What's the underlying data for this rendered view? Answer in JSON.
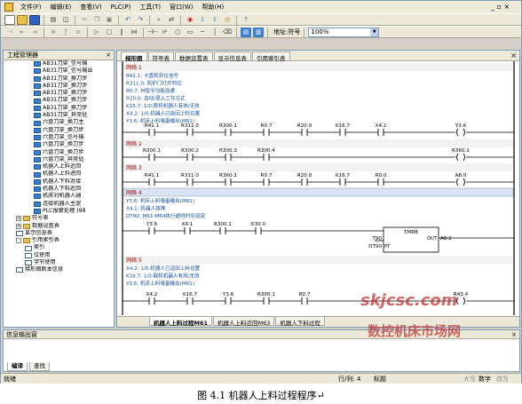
{
  "menubar": {
    "items": [
      "文件(F)",
      "编辑(E)",
      "查看(V)",
      "PLC(P)",
      "工具(T)",
      "窗口(W)",
      "帮助(H)"
    ],
    "window_controls": "_ ▫ ×"
  },
  "toolbar": {
    "address_label": "地址:符号",
    "zoom_value": "100%"
  },
  "left_pane": {
    "title": "工程管理器",
    "close": "×",
    "tree": [
      {
        "label": "AB31刀架_信号输",
        "indent": 3,
        "icon": "blue"
      },
      {
        "label": "AB31刀架_信号输出",
        "indent": 3,
        "icon": "blue"
      },
      {
        "label": "AB31刀架_换刀步",
        "indent": 3,
        "icon": "blue"
      },
      {
        "label": "AB31刀架_换刀步",
        "indent": 3,
        "icon": "blue"
      },
      {
        "label": "AB31刀架_换刀步",
        "indent": 3,
        "icon": "blue"
      },
      {
        "label": "AB31刀架_换刀步",
        "indent": 3,
        "icon": "blue"
      },
      {
        "label": "AB31刀架_换刀步",
        "indent": 3,
        "icon": "blue"
      },
      {
        "label": "AB31刀架_异常处",
        "indent": 3,
        "icon": "blue"
      },
      {
        "label": "六盘刀架_换刀主",
        "indent": 3,
        "icon": "blue"
      },
      {
        "label": "六盘刀架_换刀步",
        "indent": 3,
        "icon": "blue"
      },
      {
        "label": "六盘刀架_信号输",
        "indent": 3,
        "icon": "blue"
      },
      {
        "label": "六盘刀架_换刀步",
        "indent": 3,
        "icon": "blue"
      },
      {
        "label": "六盘刀架_换刀步",
        "indent": 3,
        "icon": "blue"
      },
      {
        "label": "六盘刀架_异常处",
        "indent": 3,
        "icon": "blue"
      },
      {
        "label": "机器人上料近回",
        "indent": 3,
        "icon": "blue"
      },
      {
        "label": "机器人上料进回",
        "indent": 3,
        "icon": "blue"
      },
      {
        "label": "机器人下料对接",
        "indent": 3,
        "icon": "blue"
      },
      {
        "label": "机器人下料近回",
        "indent": 3,
        "icon": "blue"
      },
      {
        "label": "机床对机器人通",
        "indent": 3,
        "icon": "blue"
      },
      {
        "label": "连接机器人主逻",
        "indent": 3,
        "icon": "blue"
      },
      {
        "label": "PLC报警处理 (98",
        "indent": 3,
        "icon": "blue"
      },
      {
        "label": "符号表",
        "indent": 1,
        "icon": "folder",
        "toggle": "+"
      },
      {
        "label": "数据设置表",
        "indent": 1,
        "icon": "folder",
        "toggle": "+"
      },
      {
        "label": "显示信息表",
        "indent": 1,
        "icon": "doc"
      },
      {
        "label": "引用索引表",
        "indent": 1,
        "icon": "folder",
        "toggle": "-"
      },
      {
        "label": "索引",
        "indent": 2,
        "icon": "doc"
      },
      {
        "label": "位使用",
        "indent": 2,
        "icon": "doc"
      },
      {
        "label": "字节使用",
        "indent": 2,
        "icon": "doc"
      },
      {
        "label": "梯形图断本信息",
        "indent": 1,
        "icon": "doc"
      }
    ]
  },
  "editor": {
    "tabs": [
      {
        "label": "梯形图",
        "active": true
      },
      {
        "label": "符号表",
        "active": false
      },
      {
        "label": "数据设置表",
        "active": false
      },
      {
        "label": "显示信息表",
        "active": false
      },
      {
        "label": "引用索引表",
        "active": false
      }
    ],
    "close": "×",
    "bottom_tabs": [
      {
        "label": "机器人上料过程M61",
        "active": true
      },
      {
        "label": "机器人上料近回M63",
        "active": false
      },
      {
        "label": "机器人下料过程",
        "active": false
      }
    ]
  },
  "ladder": {
    "networks": [
      {
        "title": "网络 1",
        "comments": [
          "R41.1: 卡盘松到位信号",
          "R311.0: 防护门打开到位",
          "R0.7: M指令功能选通",
          "R20.0: 自动/录入工作方式",
          "K16.7: 1/0:联机机器人有效/无效",
          "X4.2: 1/0:机器人已返回上料位置",
          "Y3.6: 机床上料堵备输出(M61)"
        ],
        "contacts": [
          "R41.1",
          "R311.0",
          "R300.1",
          "R0.7",
          "R20.0",
          "K16.7",
          "X4.2"
        ],
        "coil": "Y3.6"
      },
      {
        "title": "网络 2",
        "comments": [],
        "contacts": [
          "R300.1",
          "R300.2",
          "R300.3",
          "R300.4"
        ],
        "coil": "R360.1"
      },
      {
        "title": "网络 3",
        "comments": [],
        "contacts": [
          "R41.1",
          "R311.0",
          "R360.1",
          "R0.7",
          "R20.0",
          "K16.7",
          "R0.0"
        ],
        "coil": "A8.0"
      },
      {
        "title": "网络 4",
        "comments": [
          "Y3.6: 机床上料堵备输出(M61)",
          "X4.1: 机器人故障",
          "DT90: M61-M64执行超时时间设定"
        ],
        "contacts": [
          "Y3.6",
          "X4.1",
          "R300.1",
          "K30.0"
        ],
        "timer": {
          "name": "TMRB",
          "in_top": "T90",
          "in_bottom": "DT90",
          "pin_bottom": "PT",
          "out": "OUT",
          "coil": "A8.2"
        }
      },
      {
        "title": "网络 5",
        "comments": [
          "X4.2: 1/0:机器人已返回上料位置",
          "K16.7: 1/0:联机机器人有效/无效",
          "Y3.6: 机床上料堵备输出(M61)"
        ],
        "contacts": [
          "X4.2",
          "K16.7",
          "Y3.6",
          "R300.1",
          "R0.7"
        ],
        "coil": "R43.4"
      }
    ]
  },
  "output": {
    "title": "信息输出窗",
    "close": "×",
    "tabs": [
      {
        "label": "编译",
        "active": true
      },
      {
        "label": "查找",
        "active": false
      }
    ]
  },
  "statusbar": {
    "ready": "就绪",
    "position": "行/列: 4",
    "mode": "标题",
    "caps": "大写",
    "num": "数字",
    "ovr": "改写"
  },
  "watermark": {
    "line1": "skjcsc.com",
    "line2": "数控机床市场网"
  },
  "caption": "图 4.1  机器人上料过程程序↵"
}
